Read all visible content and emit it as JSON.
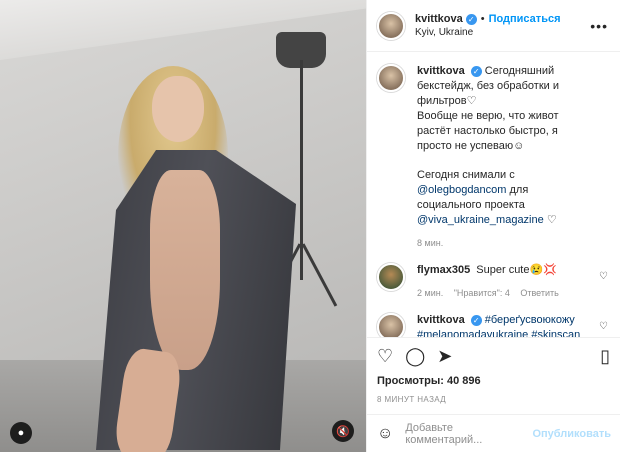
{
  "post": {
    "username": "kvittkova",
    "follow_label": "Подписаться",
    "location": "Kyiv, Ukraine",
    "more_label": "•••"
  },
  "caption": {
    "username": "kvittkova",
    "line1": "Сегодняшний бекстейдж, без обработки и фильтров♡",
    "line2": "Вообще не верю, что живот растёт настолько быстро, я просто не успеваю☺",
    "line3_prefix": "Сегодня снимали с",
    "mention1": "@olegbogdancom",
    "line3_mid": "для социального проекта",
    "mention2": "@viva_ukraine_magazine",
    "line3_suffix": "♡",
    "time": "8 мин."
  },
  "comments": [
    {
      "username": "flymax305",
      "text": "Super cute😢💢",
      "time": "2 мин.",
      "likes": "\"Нравится\": 4",
      "reply": "Ответить"
    },
    {
      "username": "kvittkova",
      "hashtags": "#береґусвоюкожу #melanomadayukraine #skinscan"
    }
  ],
  "stats": {
    "views": "Просмотры: 40 896",
    "posted_ago": "8 МИНУТ НАЗАД"
  },
  "composer": {
    "placeholder": "Добавьте комментарий...",
    "publish_label": "Опубликовать"
  },
  "icons": {
    "like": "heart-icon",
    "comment": "comment-icon",
    "share": "share-icon",
    "save": "bookmark-icon",
    "emoji": "emoji-icon",
    "user_tag": "user-tag-icon",
    "mute": "mute-icon",
    "verified": "verified-badge-icon",
    "comment_like": "heart-outline-icon"
  },
  "colors": {
    "accent": "#0095f6",
    "verified": "#3897f0",
    "muted": "#8e8e8e",
    "link": "#00376b",
    "publish_disabled": "#b2dffc"
  }
}
